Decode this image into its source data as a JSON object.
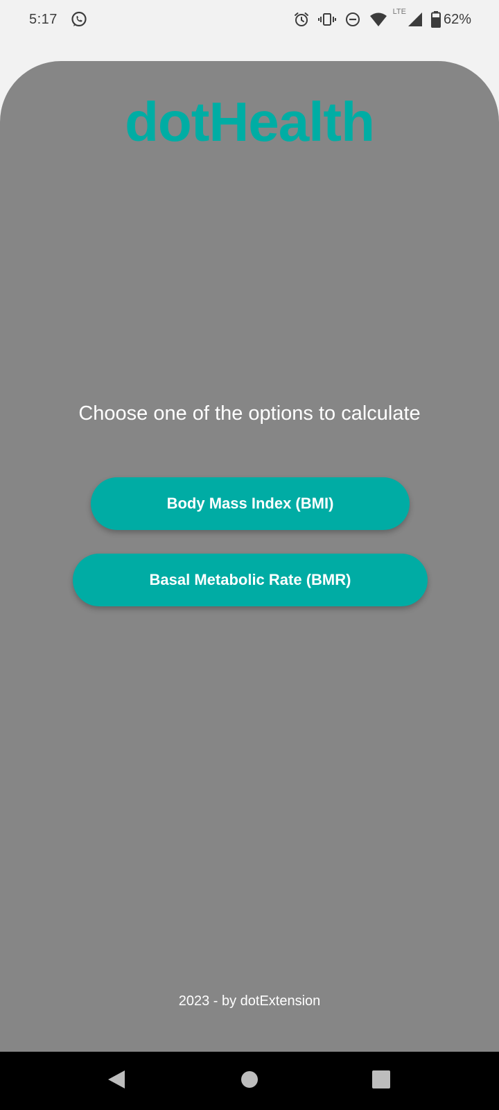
{
  "status_bar": {
    "time": "5:17",
    "notification_icons": [
      "whatsapp-icon"
    ],
    "system_icons": [
      "alarm-icon",
      "vibrate-icon",
      "do-not-disturb-icon",
      "wifi-icon",
      "lte-signal-icon",
      "battery-icon"
    ],
    "network_label": "LTE",
    "battery_percent": "62%"
  },
  "app": {
    "title": "dotHealth",
    "prompt": "Choose one of the options to calculate",
    "options": [
      {
        "label": "Body Mass Index (BMI)"
      },
      {
        "label": "Basal Metabolic Rate (BMR)"
      }
    ],
    "footer": "2023 - by dotExtension"
  },
  "navigation": {
    "buttons": [
      "back-icon",
      "home-icon",
      "recent-apps-icon"
    ]
  },
  "colors": {
    "accent": "#00ada4",
    "card_background": "#868686",
    "page_background": "#f2f2f2",
    "nav_background": "#000000"
  }
}
